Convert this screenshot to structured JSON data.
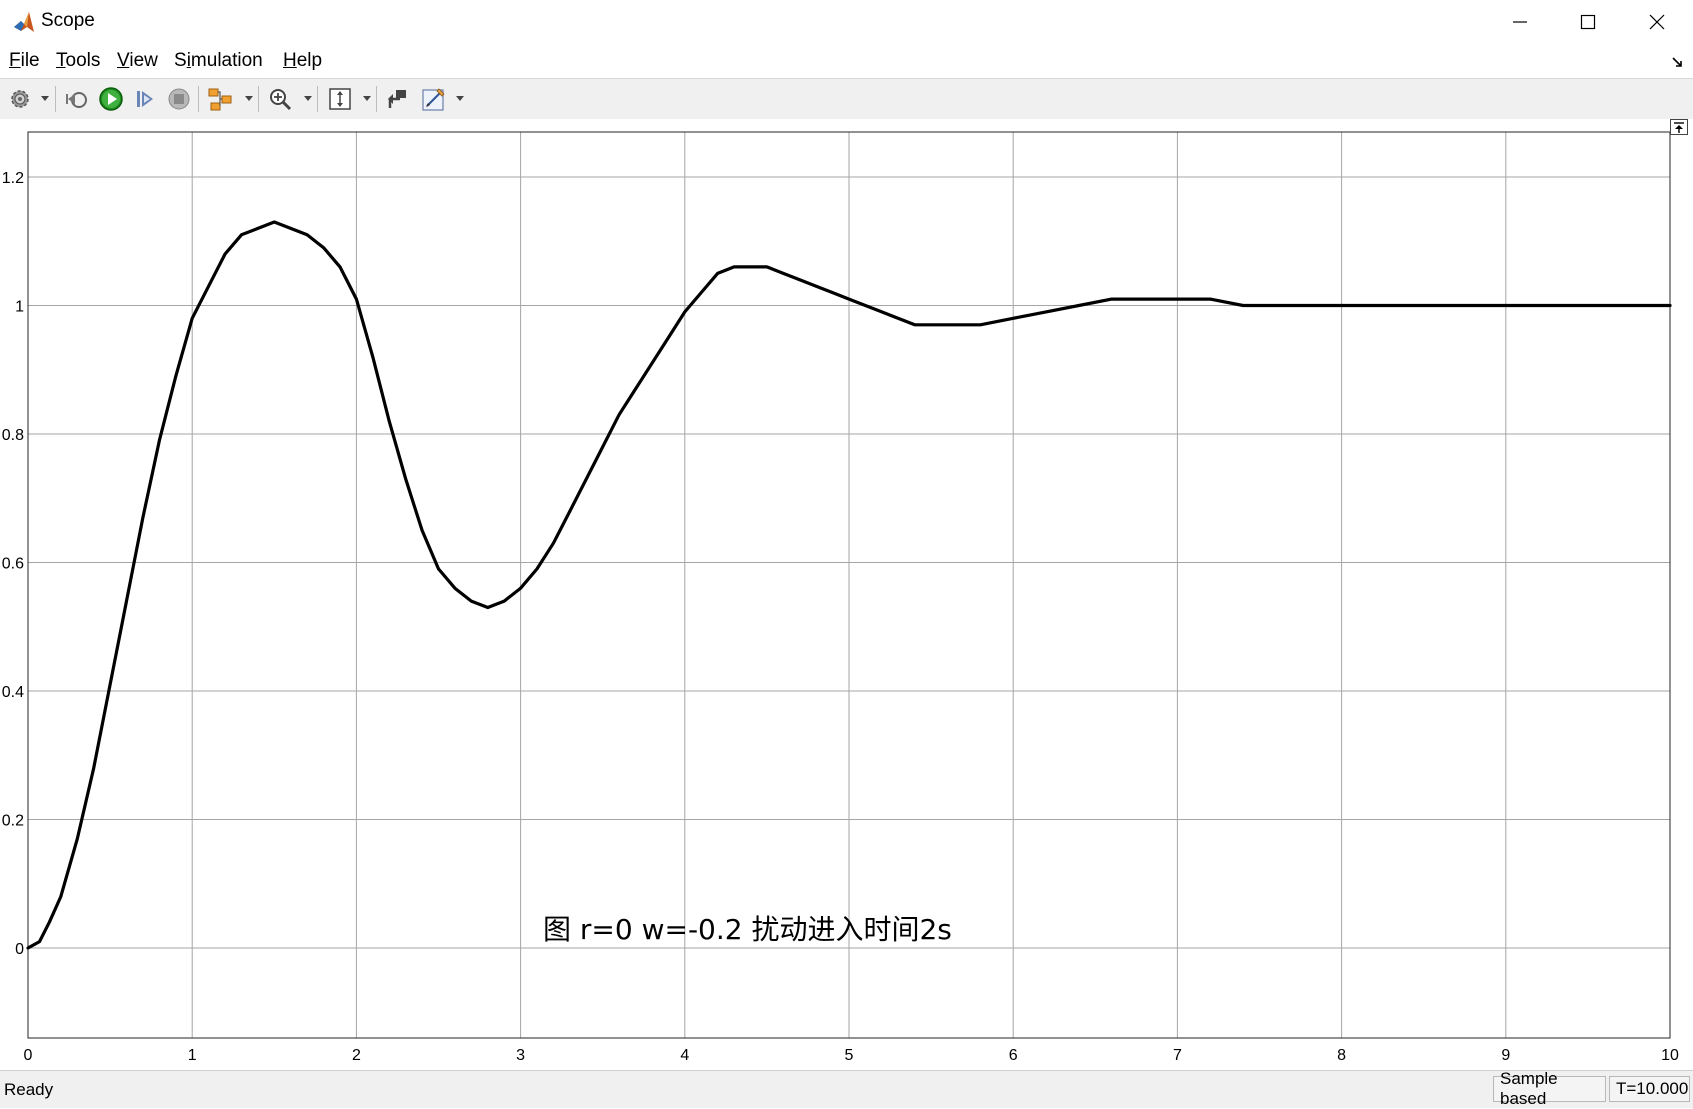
{
  "window": {
    "title": "Scope"
  },
  "menu": [
    {
      "pre": "",
      "u": "F",
      "post": "ile"
    },
    {
      "pre": "",
      "u": "T",
      "post": "ools"
    },
    {
      "pre": "",
      "u": "V",
      "post": "iew"
    },
    {
      "pre": "S",
      "u": "i",
      "post": "mulation"
    },
    {
      "pre": "",
      "u": "H",
      "post": "elp"
    }
  ],
  "toolbar": {
    "icons": [
      "settings-icon",
      "step-back-icon",
      "run-icon",
      "step-forward-icon",
      "stop-icon",
      "signal-selector-icon",
      "zoom-in-icon",
      "autoscale-icon",
      "highlight-block-icon",
      "style-icon"
    ]
  },
  "chart_data": {
    "type": "line",
    "title": "",
    "xlabel": "",
    "ylabel": "",
    "xlim": [
      0,
      10
    ],
    "ylim": [
      -0.14,
      1.27
    ],
    "x_ticks": [
      "0",
      "1",
      "2",
      "3",
      "4",
      "5",
      "6",
      "7",
      "8",
      "9",
      "10"
    ],
    "y_ticks": [
      "0",
      "0.2",
      "0.4",
      "0.6",
      "0.8",
      "1",
      "1.2"
    ],
    "grid": true,
    "annotation": "图 r=0 w=-0.2 扰动进入时间2s",
    "series": [
      {
        "color": "#000000",
        "x": [
          0,
          0.07,
          0.13,
          0.2,
          0.3,
          0.4,
          0.5,
          0.6,
          0.7,
          0.8,
          0.9,
          1.0,
          1.1,
          1.2,
          1.3,
          1.4,
          1.5,
          1.6,
          1.7,
          1.8,
          1.9,
          2.0,
          2.1,
          2.2,
          2.3,
          2.4,
          2.5,
          2.6,
          2.7,
          2.8,
          2.9,
          3.0,
          3.1,
          3.2,
          3.3,
          3.4,
          3.5,
          3.6,
          3.7,
          3.8,
          3.9,
          4.0,
          4.1,
          4.2,
          4.3,
          4.4,
          4.5,
          4.6,
          4.7,
          4.8,
          4.9,
          5.0,
          5.2,
          5.4,
          5.6,
          5.8,
          6.0,
          6.2,
          6.4,
          6.6,
          6.8,
          7.0,
          7.2,
          7.4,
          7.6,
          7.8,
          8.0,
          8.2,
          8.5,
          9.0,
          9.5,
          10.0
        ],
        "values": [
          0,
          0.01,
          0.04,
          0.08,
          0.17,
          0.28,
          0.41,
          0.54,
          0.67,
          0.79,
          0.89,
          0.98,
          1.03,
          1.08,
          1.11,
          1.12,
          1.13,
          1.12,
          1.11,
          1.09,
          1.06,
          1.01,
          0.92,
          0.82,
          0.73,
          0.65,
          0.59,
          0.56,
          0.54,
          0.53,
          0.54,
          0.56,
          0.59,
          0.63,
          0.68,
          0.73,
          0.78,
          0.83,
          0.87,
          0.91,
          0.95,
          0.99,
          1.02,
          1.05,
          1.06,
          1.06,
          1.06,
          1.05,
          1.04,
          1.03,
          1.02,
          1.01,
          0.99,
          0.97,
          0.97,
          0.97,
          0.98,
          0.99,
          1.0,
          1.01,
          1.01,
          1.01,
          1.01,
          1.0,
          1.0,
          1.0,
          1.0,
          1.0,
          1.0,
          1.0,
          1.0,
          1.0
        ]
      }
    ]
  },
  "status": {
    "left": "Ready",
    "mode": "Sample based",
    "time": "T=10.000"
  }
}
